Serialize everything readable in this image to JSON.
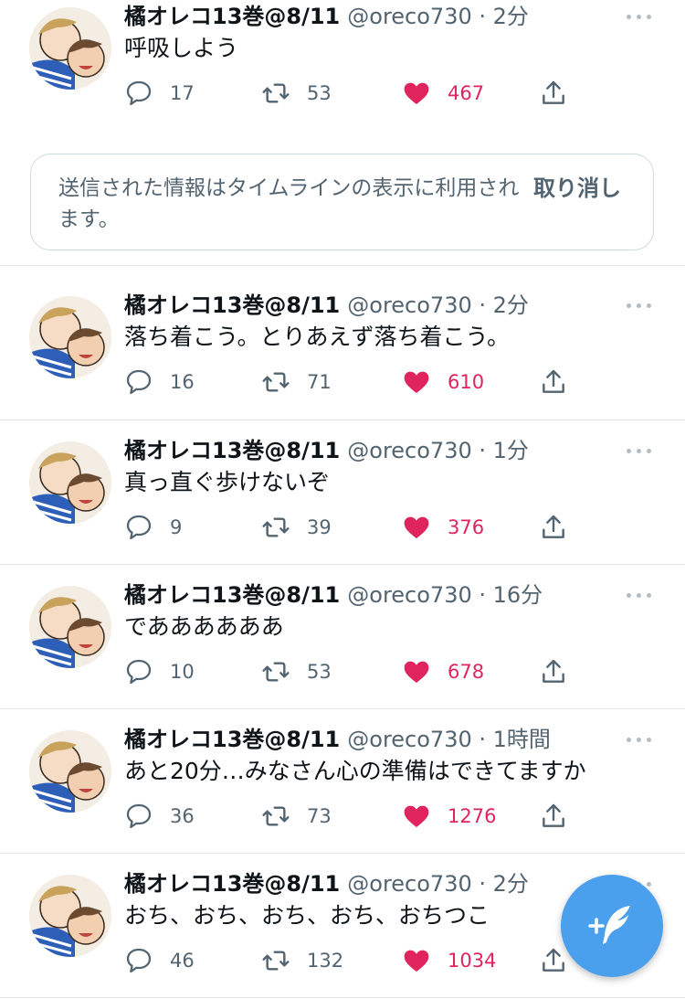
{
  "undo_notice": {
    "message": "送信された情報はタイムラインの表示に利用されます。",
    "undo_label": "取り消し"
  },
  "tweets": [
    {
      "name": "橘オレコ13巻@8/11",
      "handle_time": "@oreco730 · 2分",
      "text": "呼吸しよう",
      "replies": "17",
      "retweets": "53",
      "likes": "467"
    },
    {
      "name": "橘オレコ13巻@8/11",
      "handle_time": "@oreco730 · 2分",
      "text": "落ち着こう。とりあえず落ち着こう。",
      "replies": "16",
      "retweets": "71",
      "likes": "610"
    },
    {
      "name": "橘オレコ13巻@8/11",
      "handle_time": "@oreco730 · 1分",
      "text": "真っ直ぐ歩けないぞ",
      "replies": "9",
      "retweets": "39",
      "likes": "376"
    },
    {
      "name": "橘オレコ13巻@8/11",
      "handle_time": "@oreco730 · 16分",
      "text": "でああああああ",
      "replies": "10",
      "retweets": "53",
      "likes": "678"
    },
    {
      "name": "橘オレコ13巻@8/11",
      "handle_time": "@oreco730 · 1時間",
      "text": "あと20分…みなさん心の準備はできてますか",
      "replies": "36",
      "retweets": "73",
      "likes": "1276"
    },
    {
      "name": "橘オレコ13巻@8/11",
      "handle_time": "@oreco730 · 2分",
      "text": "おち、おち、おち、おち、おちつこ",
      "replies": "46",
      "retweets": "132",
      "likes": "1034"
    }
  ],
  "icons": {
    "reply": "reply-icon",
    "retweet": "retweet-icon",
    "like": "heart-icon",
    "share": "share-icon",
    "more": "more-icon",
    "compose": "compose-tweet-icon"
  },
  "colors": {
    "like": "#e0245e",
    "fab": "#4aa0ec",
    "secondary_text": "#536471"
  }
}
